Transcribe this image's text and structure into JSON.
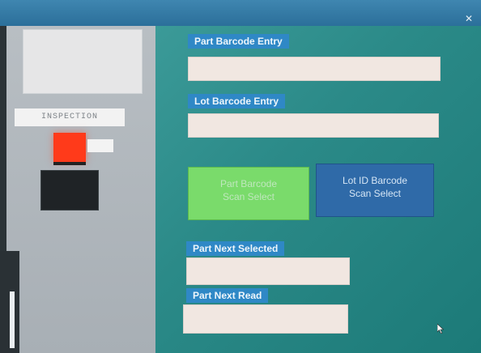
{
  "window": {
    "close_glyph": "✕"
  },
  "left": {
    "inspection_label": "INSPECTION"
  },
  "fields": {
    "part_barcode": {
      "label": "Part Barcode Entry",
      "value": ""
    },
    "lot_barcode": {
      "label": "Lot Barcode Entry",
      "value": ""
    },
    "part_next_selected": {
      "label": "Part Next Selected",
      "value": ""
    },
    "part_next_read": {
      "label": "Part Next Read",
      "value": ""
    }
  },
  "buttons": {
    "part_scan": {
      "line1": "Part Barcode",
      "line2": "Scan Select"
    },
    "lot_scan": {
      "line1": "Lot ID Barcode",
      "line2": "Scan Select"
    }
  },
  "colors": {
    "main_bg": "#2b8a88",
    "label_bg": "#2f88c6",
    "input_bg": "#f1e7e1",
    "part_btn": "#7adb6b",
    "lot_btn": "#2f6aa8",
    "status_red": "#ff3a1a"
  }
}
